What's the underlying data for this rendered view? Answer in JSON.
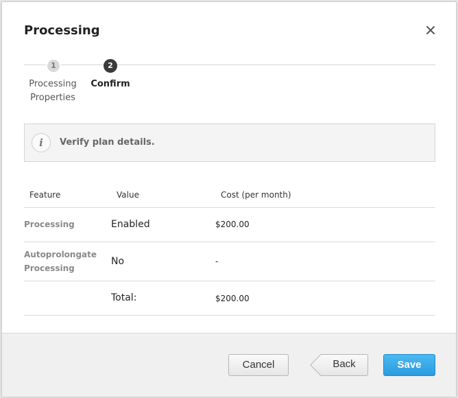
{
  "dialog": {
    "title": "Processing",
    "close_icon": "close-icon"
  },
  "steps": [
    {
      "number": "1",
      "label": "Processing Properties",
      "state": "completed"
    },
    {
      "number": "2",
      "label": "Confirm",
      "state": "active"
    }
  ],
  "info": {
    "icon": "info-icon",
    "text": "Verify plan details."
  },
  "table": {
    "headers": [
      "Feature",
      "Value",
      "Cost (per month)"
    ],
    "rows": [
      {
        "feature": "Processing",
        "value": "Enabled",
        "cost": "$200.00"
      },
      {
        "feature": "Autoprolongate Processing",
        "value": "No",
        "cost": "-"
      },
      {
        "feature": "",
        "value": "Total:",
        "cost": "$200.00"
      }
    ]
  },
  "footer": {
    "cancel_label": "Cancel",
    "back_label": "Back",
    "save_label": "Save"
  },
  "colors": {
    "primary": "#2a9ce0",
    "active_step": "#3a3a3a",
    "inactive_step": "#d9d9d9"
  }
}
